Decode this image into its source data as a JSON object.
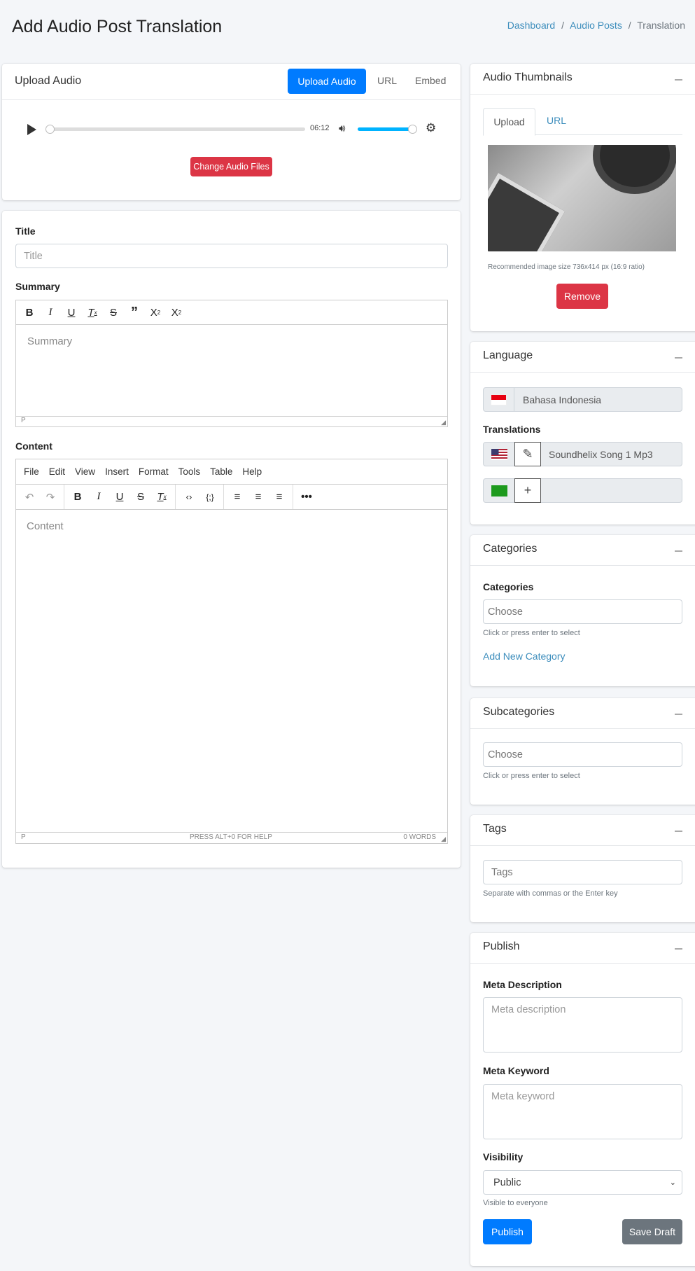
{
  "page": {
    "title": "Add Audio Post Translation"
  },
  "breadcrumb": [
    {
      "label": "Dashboard"
    },
    {
      "label": "Audio Posts"
    },
    {
      "label": "Translation"
    }
  ],
  "upload_audio": {
    "title": "Upload Audio",
    "tabs": [
      "Upload Audio",
      "URL",
      "Embed"
    ],
    "active_tab": "Upload Audio",
    "player": {
      "time": "06:12",
      "progress": 0,
      "volume": 1
    },
    "change_button": "Change Audio Files"
  },
  "form": {
    "title_label": "Title",
    "title_placeholder": "Title",
    "summary_label": "Summary",
    "summary_placeholder": "Summary",
    "summary_status": "P",
    "content_label": "Content",
    "content_placeholder": "Content",
    "content_menu": [
      "File",
      "Edit",
      "View",
      "Insert",
      "Format",
      "Tools",
      "Table",
      "Help"
    ],
    "content_status_path": "P",
    "content_status_help": "PRESS ALT+0 FOR HELP",
    "content_word_count": "0 WORDS"
  },
  "thumbnails": {
    "title": "Audio Thumbnails",
    "tabs": [
      "Upload",
      "URL"
    ],
    "active_tab": "Upload",
    "recommend": "Recommended image size 736x414 px (16:9 ratio)",
    "remove_button": "Remove"
  },
  "language": {
    "title": "Language",
    "current": "Bahasa Indonesia",
    "translations_label": "Translations",
    "translations": [
      {
        "flag": "us",
        "value": "Soundhelix Song 1 Mp3",
        "action": "edit"
      },
      {
        "flag": "sa",
        "value": "",
        "action": "add"
      }
    ]
  },
  "categories": {
    "title": "Categories",
    "label": "Categories",
    "placeholder": "Choose",
    "help": "Click or press enter to select",
    "add_link": "Add New Category"
  },
  "subcategories": {
    "title": "Subcategories",
    "placeholder": "Choose",
    "help": "Click or press enter to select"
  },
  "tags": {
    "title": "Tags",
    "placeholder": "Tags",
    "help": "Separate with commas or the Enter key"
  },
  "publish": {
    "title": "Publish",
    "meta_description_label": "Meta Description",
    "meta_description_placeholder": "Meta description",
    "meta_keyword_label": "Meta Keyword",
    "meta_keyword_placeholder": "Meta keyword",
    "visibility_label": "Visibility",
    "visibility_value": "Public",
    "visibility_help": "Visible to everyone",
    "publish_button": "Publish",
    "save_draft_button": "Save Draft"
  },
  "colors": {
    "primary": "#007bff",
    "danger": "#dc3545",
    "secondary": "#6c757d",
    "link": "#3c8dbc",
    "player_accent": "#00b3ff"
  }
}
